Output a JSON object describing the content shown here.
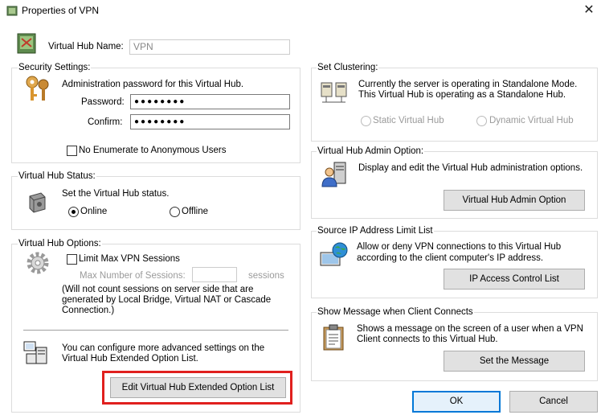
{
  "window": {
    "title": "Properties of VPN",
    "close_glyph": "✕"
  },
  "hub_name": {
    "label": "Virtual Hub Name:",
    "value": "VPN"
  },
  "security": {
    "legend": "Security Settings:",
    "description": "Administration password for this Virtual Hub.",
    "password_label": "Password:",
    "password_value": "●●●●●●●●",
    "confirm_label": "Confirm:",
    "confirm_value": "●●●●●●●●",
    "no_enum_label": "No Enumerate to Anonymous Users",
    "no_enum_checked": false
  },
  "status": {
    "legend": "Virtual Hub Status:",
    "description": "Set the Virtual Hub status.",
    "online_label": "Online",
    "offline_label": "Offline",
    "selected": "Online"
  },
  "options": {
    "legend": "Virtual Hub Options:",
    "limit_label": "Limit Max VPN Sessions",
    "limit_checked": false,
    "max_label": "Max Number of Sessions:",
    "max_value": "",
    "sessions_unit": "sessions",
    "note_line1": "(Will not count sessions on server side that are",
    "note_line2": "generated by Local Bridge, Virtual NAT or Cascade",
    "note_line3": "Connection.)",
    "adv_line1": "You can configure more advanced settings on the",
    "adv_line2": "Virtual Hub Extended Option List.",
    "adv_button": "Edit Virtual Hub Extended Option List"
  },
  "clustering": {
    "legend": "Set Clustering:",
    "line1": "Currently the server is operating in Standalone Mode.",
    "line2": "This Virtual Hub is operating as a Standalone Hub.",
    "static_label": "Static Virtual Hub",
    "dynamic_label": "Dynamic Virtual Hub"
  },
  "admin_option": {
    "legend": "Virtual Hub Admin Option:",
    "description": "Display and edit the Virtual Hub administration options.",
    "button": "Virtual Hub Admin Option"
  },
  "ip_limit": {
    "legend": "Source IP Address Limit List",
    "line1": "Allow or deny VPN connections to this Virtual Hub",
    "line2": "according to the client computer's IP address.",
    "button": "IP Access Control List"
  },
  "message": {
    "legend": "Show Message when Client Connects",
    "line1": "Shows a message on the screen of a user when a VPN",
    "line2": "Client connects to this Virtual Hub.",
    "button": "Set the Message"
  },
  "footer": {
    "ok": "OK",
    "cancel": "Cancel"
  },
  "colors": {
    "highlight": "#e0201e",
    "accent": "#0078d7"
  }
}
